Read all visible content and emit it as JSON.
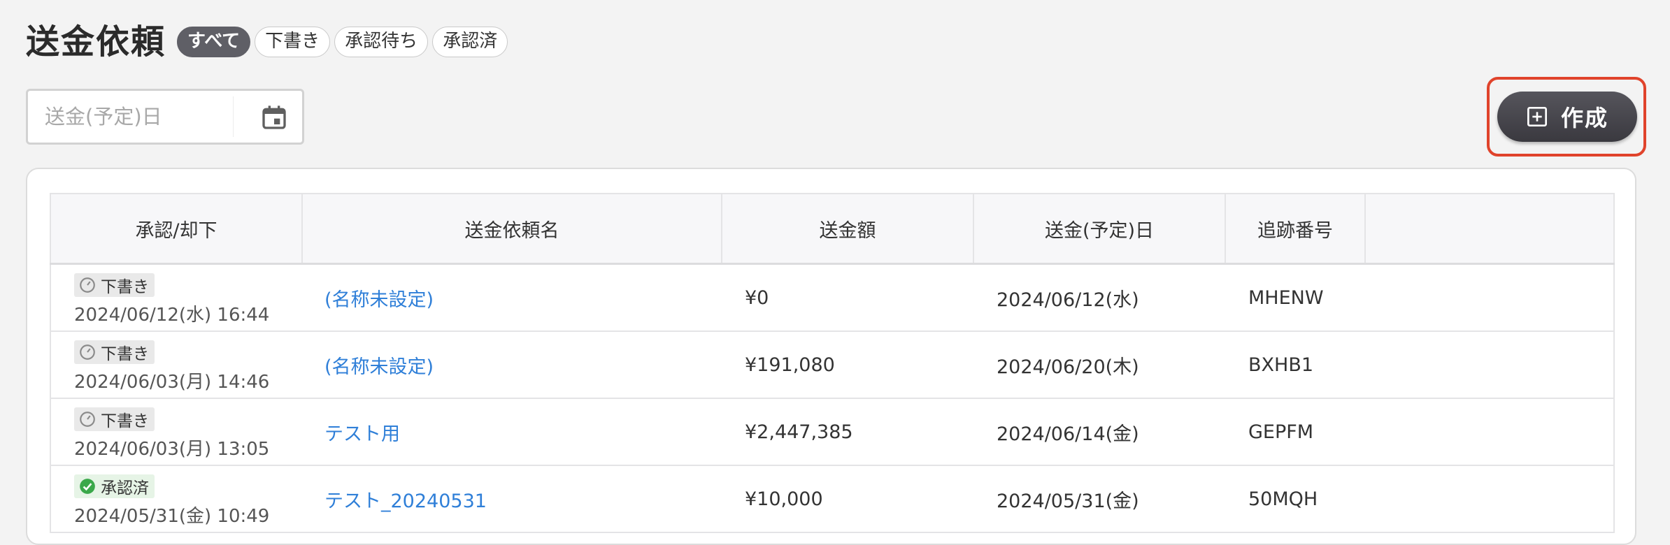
{
  "page": {
    "title": "送金依頼"
  },
  "filters": [
    {
      "label": "すべて",
      "active": true
    },
    {
      "label": "下書き",
      "active": false
    },
    {
      "label": "承認待ち",
      "active": false
    },
    {
      "label": "承認済",
      "active": false
    }
  ],
  "date_filter": {
    "placeholder": "送金(予定)日",
    "value": ""
  },
  "toolbar": {
    "create_label": "作成",
    "highlight_color": "#e0432b"
  },
  "table": {
    "headers": [
      "承認/却下",
      "送金依頼名",
      "送金額",
      "送金(予定)日",
      "追跡番号",
      ""
    ],
    "rows": [
      {
        "status": "下書き",
        "status_icon": "clock-icon",
        "status_date": "2024/06/12(水) 16:44",
        "name": "(名称未設定)",
        "amount": "¥0",
        "date": "2024/06/12(水)",
        "tracking": "MHENW"
      },
      {
        "status": "下書き",
        "status_icon": "clock-icon",
        "status_date": "2024/06/03(月) 14:46",
        "name": "(名称未設定)",
        "amount": "¥191,080",
        "date": "2024/06/20(木)",
        "tracking": "BXHB1"
      },
      {
        "status": "下書き",
        "status_icon": "clock-icon",
        "status_date": "2024/06/03(月) 13:05",
        "name": "テスト用",
        "amount": "¥2,447,385",
        "date": "2024/06/14(金)",
        "tracking": "GEPFM"
      },
      {
        "status": "承認済",
        "status_icon": "check-circle-icon",
        "status_date": "2024/05/31(金) 10:49",
        "name": "テスト_20240531",
        "amount": "¥10,000",
        "date": "2024/05/31(金)",
        "tracking": "50MQH"
      }
    ]
  },
  "colors": {
    "link": "#2f7fd8",
    "approved_green": "#3aa84a",
    "active_tab": "#5f5f66"
  }
}
